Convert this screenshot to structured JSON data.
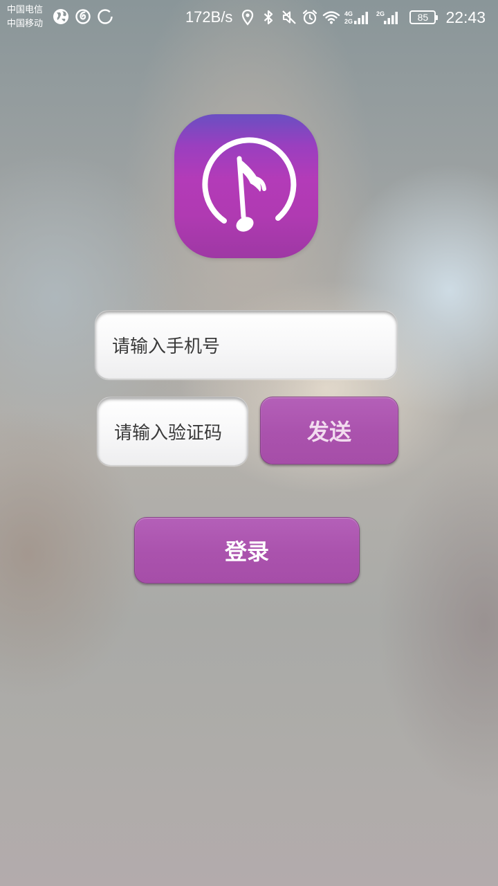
{
  "status_bar": {
    "carrier_1": "中国电信",
    "carrier_2": "中国移动",
    "left_icons": [
      "earth-icon",
      "netease-music-icon",
      "loading-circle-icon"
    ],
    "network_speed": "172B/s",
    "right_icons": [
      "location-icon",
      "bluetooth-icon",
      "mute-icon",
      "alarm-icon",
      "wifi-icon",
      "signal-4g-icon",
      "signal-2g-icon"
    ],
    "signal_labels": [
      "4G",
      "2G",
      "2G"
    ],
    "battery_level": "85",
    "time": "22:43"
  },
  "logo": {
    "icon": "music-note-icon",
    "colors": {
      "top": "#6a4fc2",
      "middle": "#b33bb8",
      "bottom": "#9e38a4"
    }
  },
  "form": {
    "phone_placeholder": "请输入手机号",
    "code_placeholder": "请输入验证码",
    "send_label": "发送",
    "login_label": "登录"
  },
  "colors": {
    "accent": "#aa52ad",
    "input_text": "#3a3a3a"
  }
}
